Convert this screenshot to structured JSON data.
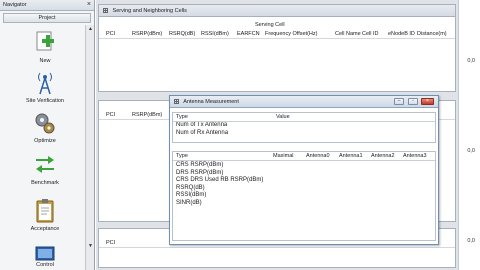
{
  "navigator": {
    "title": "Navigator",
    "close_glyph": "×",
    "project_label": "Project",
    "items": [
      {
        "label": "New",
        "icon": "new-plus-icon"
      },
      {
        "label": "Site Verification",
        "icon": "antenna-tower-icon"
      },
      {
        "label": "Optimize",
        "icon": "gears-icon"
      },
      {
        "label": "Benchmark",
        "icon": "arrows-icon"
      },
      {
        "label": "Acceptance",
        "icon": "clipboard-icon"
      },
      {
        "label": "Control",
        "icon": "monitor-icon"
      }
    ],
    "scroll_up": "▲",
    "scroll_down": "▼"
  },
  "panel": {
    "title": "Serving and Neighboring Cells",
    "group_header": "Serving Cell",
    "columns": [
      "PCI",
      "RSRP(dBm)",
      "RSRQ(dB)",
      "RSSI(dBm)",
      "EARFCN",
      "Frequency Offset(Hz)",
      "Cell Name",
      "Cell ID",
      "eNodeB ID",
      "Distance(m)"
    ],
    "neighbor_columns": [
      "PCI",
      "RSRP(dBm)"
    ],
    "bottom_columns": [
      "PCI"
    ]
  },
  "scale_labels": [
    "0,0",
    "0,0",
    "0,0"
  ],
  "dialog": {
    "title": "Antenna Measurement",
    "buttons": {
      "minimize": "–",
      "maximize": "▫",
      "close": "×"
    },
    "top_table": {
      "headers": [
        "Type",
        "Value"
      ],
      "rows": [
        "Num of Tx Antenna",
        "Num of Rx Antenna"
      ]
    },
    "bottom_table": {
      "headers": [
        "Type",
        "Maximal",
        "Antenna0",
        "Antenna1",
        "Antenna2",
        "Antenna3"
      ],
      "rows": [
        "CRS RSRP(dBm)",
        "DRS RSRP(dBm)",
        "CRS DRS Used RB RSRP(dBm)",
        "RSRQ(dB)",
        "RSSI(dBm)",
        "SINR(dB)"
      ]
    }
  },
  "colors": {
    "accent_green": "#3aa33a",
    "tower_blue": "#2e5fa8",
    "close_red": "#c2392b"
  }
}
